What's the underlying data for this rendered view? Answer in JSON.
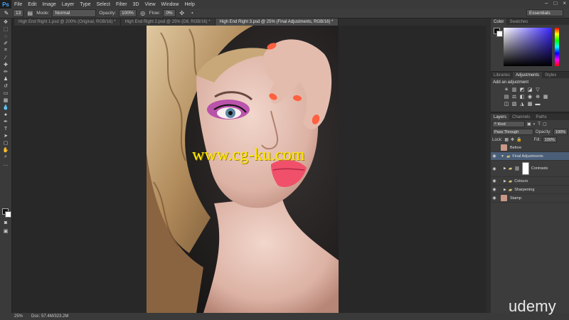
{
  "app_logo": "Ps",
  "menu": [
    "File",
    "Edit",
    "Image",
    "Layer",
    "Type",
    "Select",
    "Filter",
    "3D",
    "View",
    "Window",
    "Help"
  ],
  "window_controls": [
    "–",
    "□",
    "×"
  ],
  "workspace": "Essentials",
  "options_bar": {
    "size_value": "13",
    "mode_label": "Mode:",
    "mode_value": "Normal",
    "opacity_label": "Opacity:",
    "opacity_value": "100%",
    "flow_label": "Flow:",
    "flow_value": "0%"
  },
  "tabs": [
    {
      "label": "High End Right 1.psd @ 200% (Original, RGB/16) *",
      "active": false
    },
    {
      "label": "High End Right 2.psd @ 25% (D8, RGB/16) *",
      "active": false
    },
    {
      "label": "High End Right 3.psd @ 25% (Final Adjustments, RGB/16) *",
      "active": true
    }
  ],
  "watermark": "www.cg-ku.com",
  "status": {
    "zoom": "25%",
    "doc": "Doc: 57.4M/323.2M"
  },
  "brand": "udemy",
  "color_panel": {
    "tabs": [
      "Color",
      "Swatches"
    ]
  },
  "adjustments_panel": {
    "tabs": [
      "Libraries",
      "Adjustments",
      "Styles"
    ],
    "title": "Add an adjustment"
  },
  "layers_panel": {
    "tabs": [
      "Layers",
      "Channels",
      "Paths"
    ],
    "kind_label": "Kind",
    "blend_mode": "Pass Through",
    "opacity_label": "Opacity:",
    "opacity_value": "100%",
    "lock_label": "Lock:",
    "fill_label": "Fill:",
    "fill_value": "100%",
    "layers": [
      {
        "name": "Before",
        "type": "image",
        "visible": false,
        "selected": false,
        "indent": 0
      },
      {
        "name": "Final Adjustments",
        "type": "group",
        "visible": true,
        "selected": true,
        "indent": 0
      },
      {
        "name": "Contrasts",
        "type": "group-masked",
        "visible": true,
        "selected": false,
        "indent": 1
      },
      {
        "name": "Colours",
        "type": "group",
        "visible": true,
        "selected": false,
        "indent": 1
      },
      {
        "name": "Sharpening",
        "type": "group",
        "visible": true,
        "selected": false,
        "indent": 1
      },
      {
        "name": "Stamp",
        "type": "image",
        "visible": true,
        "selected": false,
        "indent": 0
      }
    ]
  }
}
